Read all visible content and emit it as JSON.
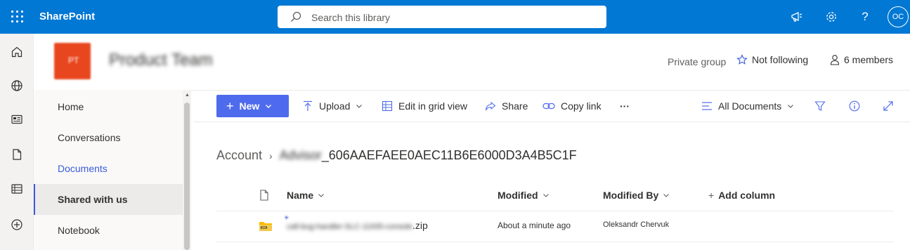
{
  "suite": {
    "app_name": "SharePoint",
    "search_placeholder": "Search this library",
    "avatar_initials": "OC"
  },
  "site": {
    "logo_letter": "PT",
    "title": "Product Team",
    "privacy": "Private group",
    "follow_label": "Not following",
    "members_label": "6 members"
  },
  "nav": {
    "items": [
      {
        "label": "Home"
      },
      {
        "label": "Conversations"
      },
      {
        "label": "Documents"
      },
      {
        "label": "Shared with us"
      },
      {
        "label": "Notebook"
      }
    ]
  },
  "commands": {
    "new": "New",
    "upload": "Upload",
    "edit_grid": "Edit in grid view",
    "share": "Share",
    "copy_link": "Copy link",
    "more": "···",
    "view": "All Documents"
  },
  "breadcrumb": {
    "root": "Account",
    "current_prefix": "Advisor",
    "current_suffix": "_606AAEFAEE0AEC11B6E6000D3A4B5C1F"
  },
  "list": {
    "headers": {
      "name": "Name",
      "modified": "Modified",
      "modified_by": "Modified By",
      "add_column": "Add column"
    },
    "rows": [
      {
        "name_blurred": "call-bug-handler-SLC-11935-console",
        "name_ext": ".zip",
        "modified": "About a minute ago",
        "modified_by": "Oleksandr Chervuk"
      }
    ]
  },
  "colors": {
    "suite_bar": "#0078d4",
    "accent": "#4f6bed",
    "site_logo": "#e8461e"
  }
}
